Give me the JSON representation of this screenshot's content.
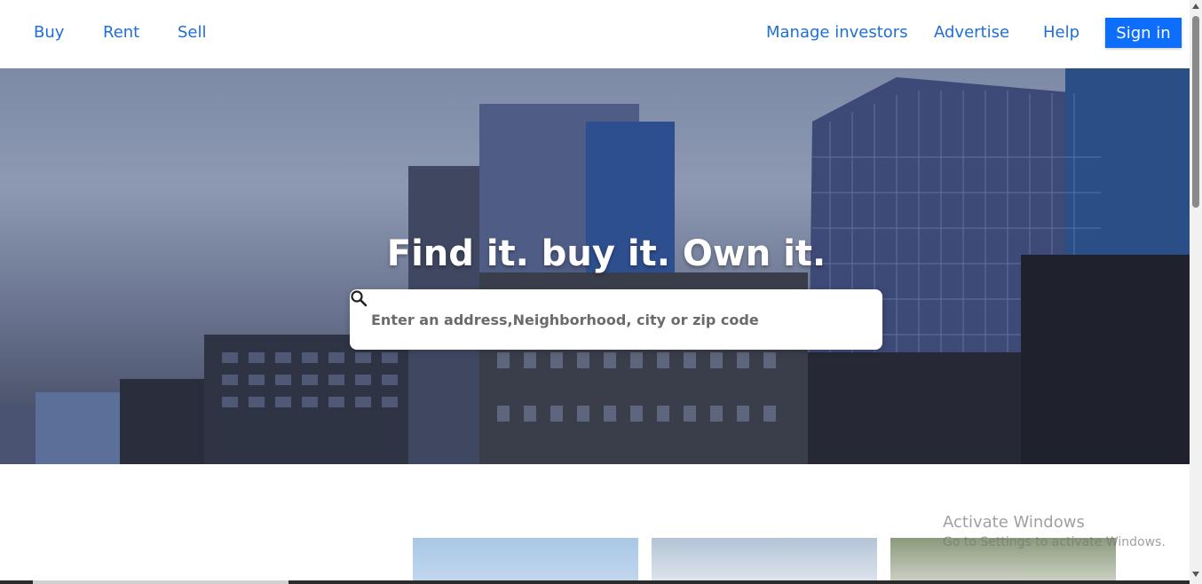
{
  "nav": {
    "left_links": [
      "Buy",
      "Rent",
      "Sell"
    ],
    "right_links": [
      "Manage investors",
      "Advertise",
      "Help"
    ],
    "signin_label": "Sign in",
    "accent_color": "#0d6efd",
    "link_color": "#1f6fd4"
  },
  "hero": {
    "title": "Find it. buy it. Own it.",
    "search_placeholder": "Enter an address,Neighborhood, city or zip code",
    "search_icon": "search-icon"
  },
  "watermark": {
    "line1": "Activate Windows",
    "line2": "Go to Settings to activate Windows."
  }
}
